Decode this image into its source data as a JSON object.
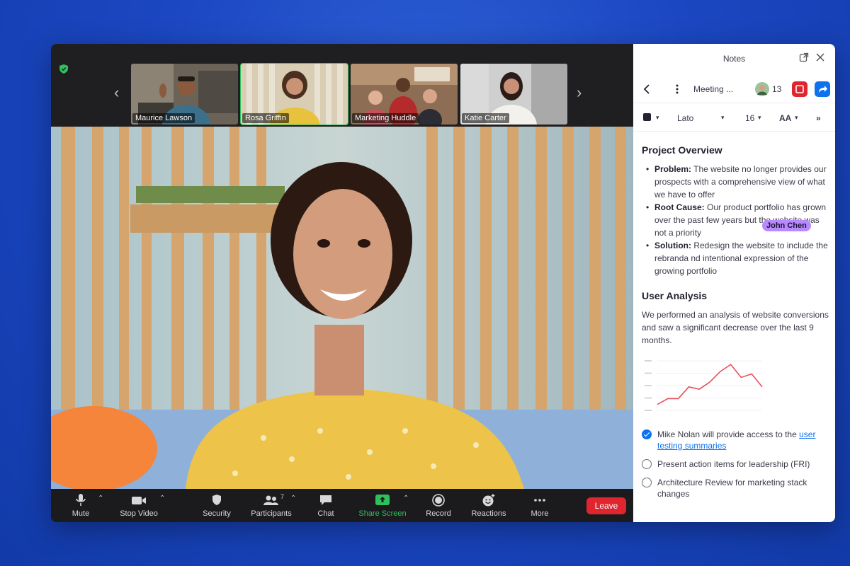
{
  "strip": {
    "tiles": [
      {
        "name": "Maurice Lawson"
      },
      {
        "name": "Rosa Griffin",
        "active": true
      },
      {
        "name": "Marketing Huddle"
      },
      {
        "name": "Katie Carter"
      }
    ]
  },
  "toolbar": {
    "mute": "Mute",
    "stop_video": "Stop Video",
    "security": "Security",
    "participants": "Participants",
    "participants_count": "7",
    "chat": "Chat",
    "share_screen": "Share Screen",
    "record": "Record",
    "reactions": "Reactions",
    "more": "More",
    "leave": "Leave"
  },
  "notes": {
    "title": "Notes",
    "doc_name": "Meeting ...",
    "participants_count": "13",
    "font_name": "Lato",
    "font_size": "16",
    "text_size_icon": "AA",
    "cursor_user": "John Chen",
    "section1": {
      "heading": "Project Overview",
      "items": [
        {
          "label": "Problem:",
          "text": " The website no longer provides our prospects with a comprehensive view of what we have to offer"
        },
        {
          "label": "Root Cause:",
          "text": " Our product portfolio has grown over the past few years but the website was not a priority"
        },
        {
          "label": "Solution:",
          "text": " Redesign the website to include the rebranda nd intentional expression of the growing portfolio"
        }
      ]
    },
    "section2": {
      "heading": "User Analysis",
      "paragraph": "We performed an analysis of website conversions and saw a significant decrease over the last 9 months."
    },
    "tasks": [
      {
        "text": "Mike Nolan will provide access to the ",
        "link": "user testing summaries",
        "checked": true
      },
      {
        "text": "Present action items for leadership (FRI)",
        "checked": false
      },
      {
        "text": "Architecture Review for marketing stack changes",
        "checked": false
      }
    ]
  },
  "colors": {
    "accent_blue": "#0e72ed",
    "leave_red": "#e0252f",
    "active_green": "#2fbf5d",
    "cursor_purple": "#b889ff",
    "chart_line": "#e8505b"
  },
  "chart_data": {
    "type": "line",
    "series": [
      {
        "values": [
          1,
          2,
          2,
          4,
          3.6,
          4.8,
          6.6,
          7.8,
          5.6,
          6.2,
          4
        ]
      }
    ]
  }
}
